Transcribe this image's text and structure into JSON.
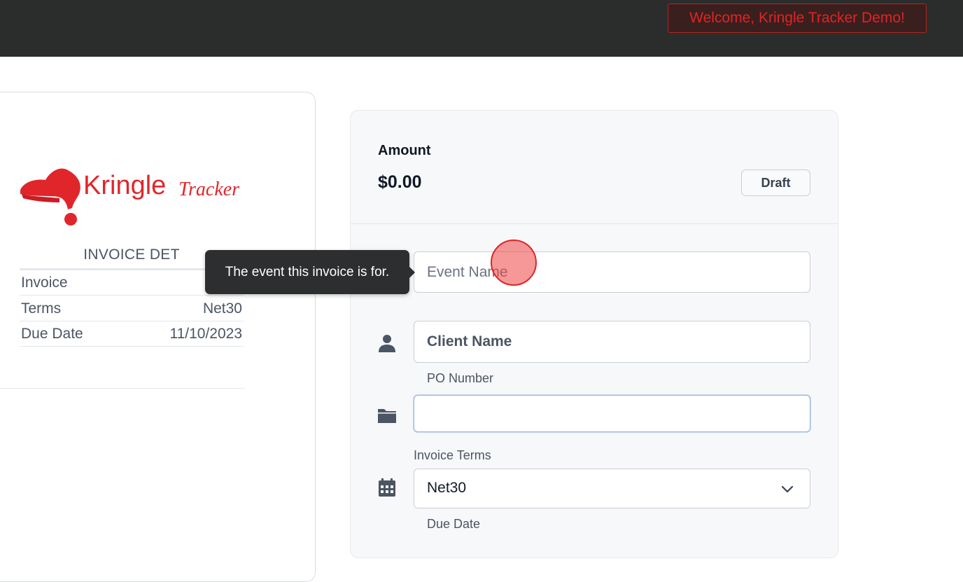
{
  "header": {
    "welcome_text": "Welcome, Kringle Tracker Demo!"
  },
  "logo": {
    "word1": "Kringle",
    "word2": "Tracker",
    "brand_color": "#e0262b"
  },
  "invoice_details": {
    "title": "INVOICE DET",
    "rows": [
      {
        "label": "Invoice",
        "value": ""
      },
      {
        "label": "Terms",
        "value": "Net30"
      },
      {
        "label": "Due Date",
        "value": "11/10/2023"
      }
    ]
  },
  "summary": {
    "amount_label": "Amount",
    "amount_value": "$0.00",
    "status_button": "Draft"
  },
  "form": {
    "event_name": {
      "placeholder": "Event Name",
      "value": ""
    },
    "client_name": {
      "placeholder": "Client Name",
      "value": ""
    },
    "po_number": {
      "label": "PO Number",
      "value": ""
    },
    "invoice_terms": {
      "label": "Invoice Terms",
      "selected": "Net30"
    },
    "due_date": {
      "label": "Due Date"
    }
  },
  "tooltip": {
    "text": "The event this invoice is for."
  },
  "icons": {
    "client": "user-icon",
    "po": "folder-icon",
    "terms": "calendar-icon",
    "select": "chevron-down-icon"
  }
}
